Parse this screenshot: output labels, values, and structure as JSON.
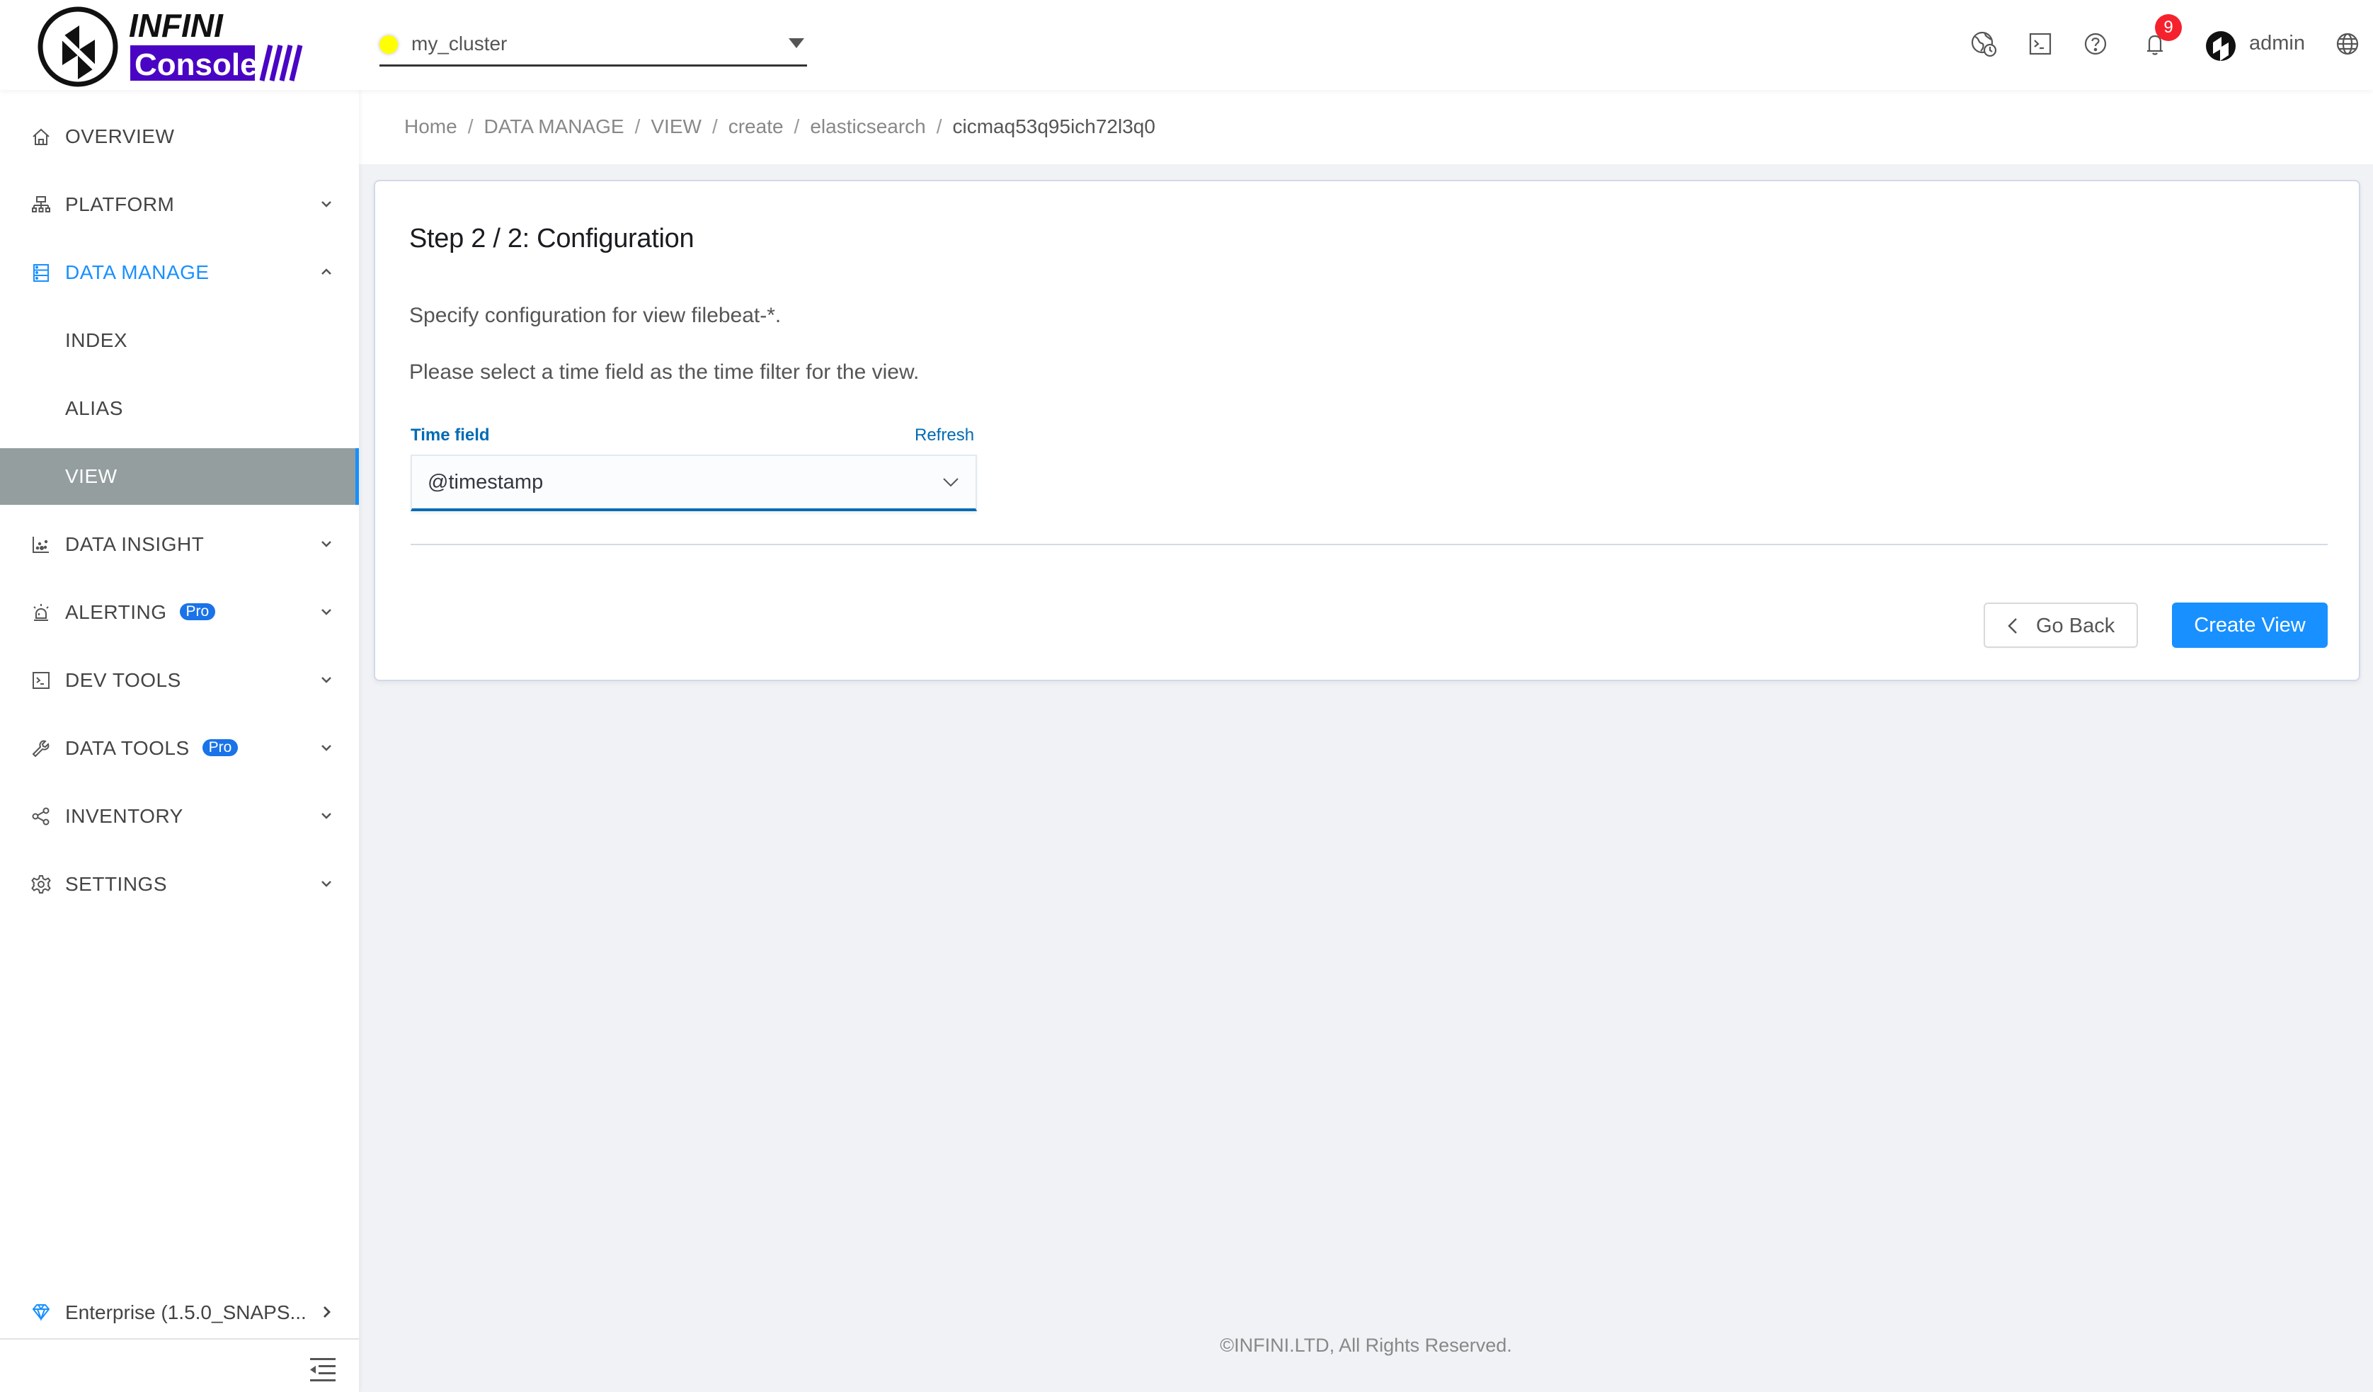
{
  "app": {
    "brand_top": "INFINI",
    "brand_bottom": "Console",
    "brand_color": "#4a05c4"
  },
  "header": {
    "cluster": {
      "name": "my_cluster",
      "status_color": "#ffff00"
    },
    "icons": [
      "globe-clock-icon",
      "terminal-icon",
      "help-icon",
      "bell-icon",
      "globe-icon"
    ],
    "notification_count": "9",
    "user": "admin"
  },
  "sidebar": {
    "items": [
      {
        "label": "OVERVIEW",
        "icon": "home-icon",
        "expandable": false
      },
      {
        "label": "PLATFORM",
        "icon": "sitemap-icon",
        "expandable": true
      },
      {
        "label": "DATA MANAGE",
        "icon": "database-icon",
        "expandable": true,
        "open": true
      },
      {
        "label": "INDEX",
        "sub": true
      },
      {
        "label": "ALIAS",
        "sub": true
      },
      {
        "label": "VIEW",
        "sub": true,
        "selected": true
      },
      {
        "label": "DATA INSIGHT",
        "icon": "scatter-chart-icon",
        "expandable": true
      },
      {
        "label": "ALERTING",
        "icon": "siren-icon",
        "expandable": true,
        "badge": "Pro"
      },
      {
        "label": "DEV TOOLS",
        "icon": "terminal-icon",
        "expandable": true
      },
      {
        "label": "DATA TOOLS",
        "icon": "wrench-icon",
        "expandable": true,
        "badge": "Pro"
      },
      {
        "label": "INVENTORY",
        "icon": "share-nodes-icon",
        "expandable": true
      },
      {
        "label": "SETTINGS",
        "icon": "gear-icon",
        "expandable": true
      }
    ],
    "edition": "Enterprise (1.5.0_SNAPS...",
    "accent": "#1890ff"
  },
  "breadcrumb": [
    "Home",
    "DATA MANAGE",
    "VIEW",
    "create",
    "elasticsearch",
    "cicmaq53q95ich72l3q0"
  ],
  "card": {
    "title": "Step 2 / 2: Configuration",
    "description": "Specify configuration for view filebeat-*.",
    "instruction": "Please select a time field as the time filter for the view.",
    "time_field": {
      "label": "Time field",
      "refresh_label": "Refresh",
      "value": "@timestamp"
    },
    "buttons": {
      "back": "Go Back",
      "create": "Create View"
    }
  },
  "footer": "©INFINI.LTD, All Rights Reserved."
}
